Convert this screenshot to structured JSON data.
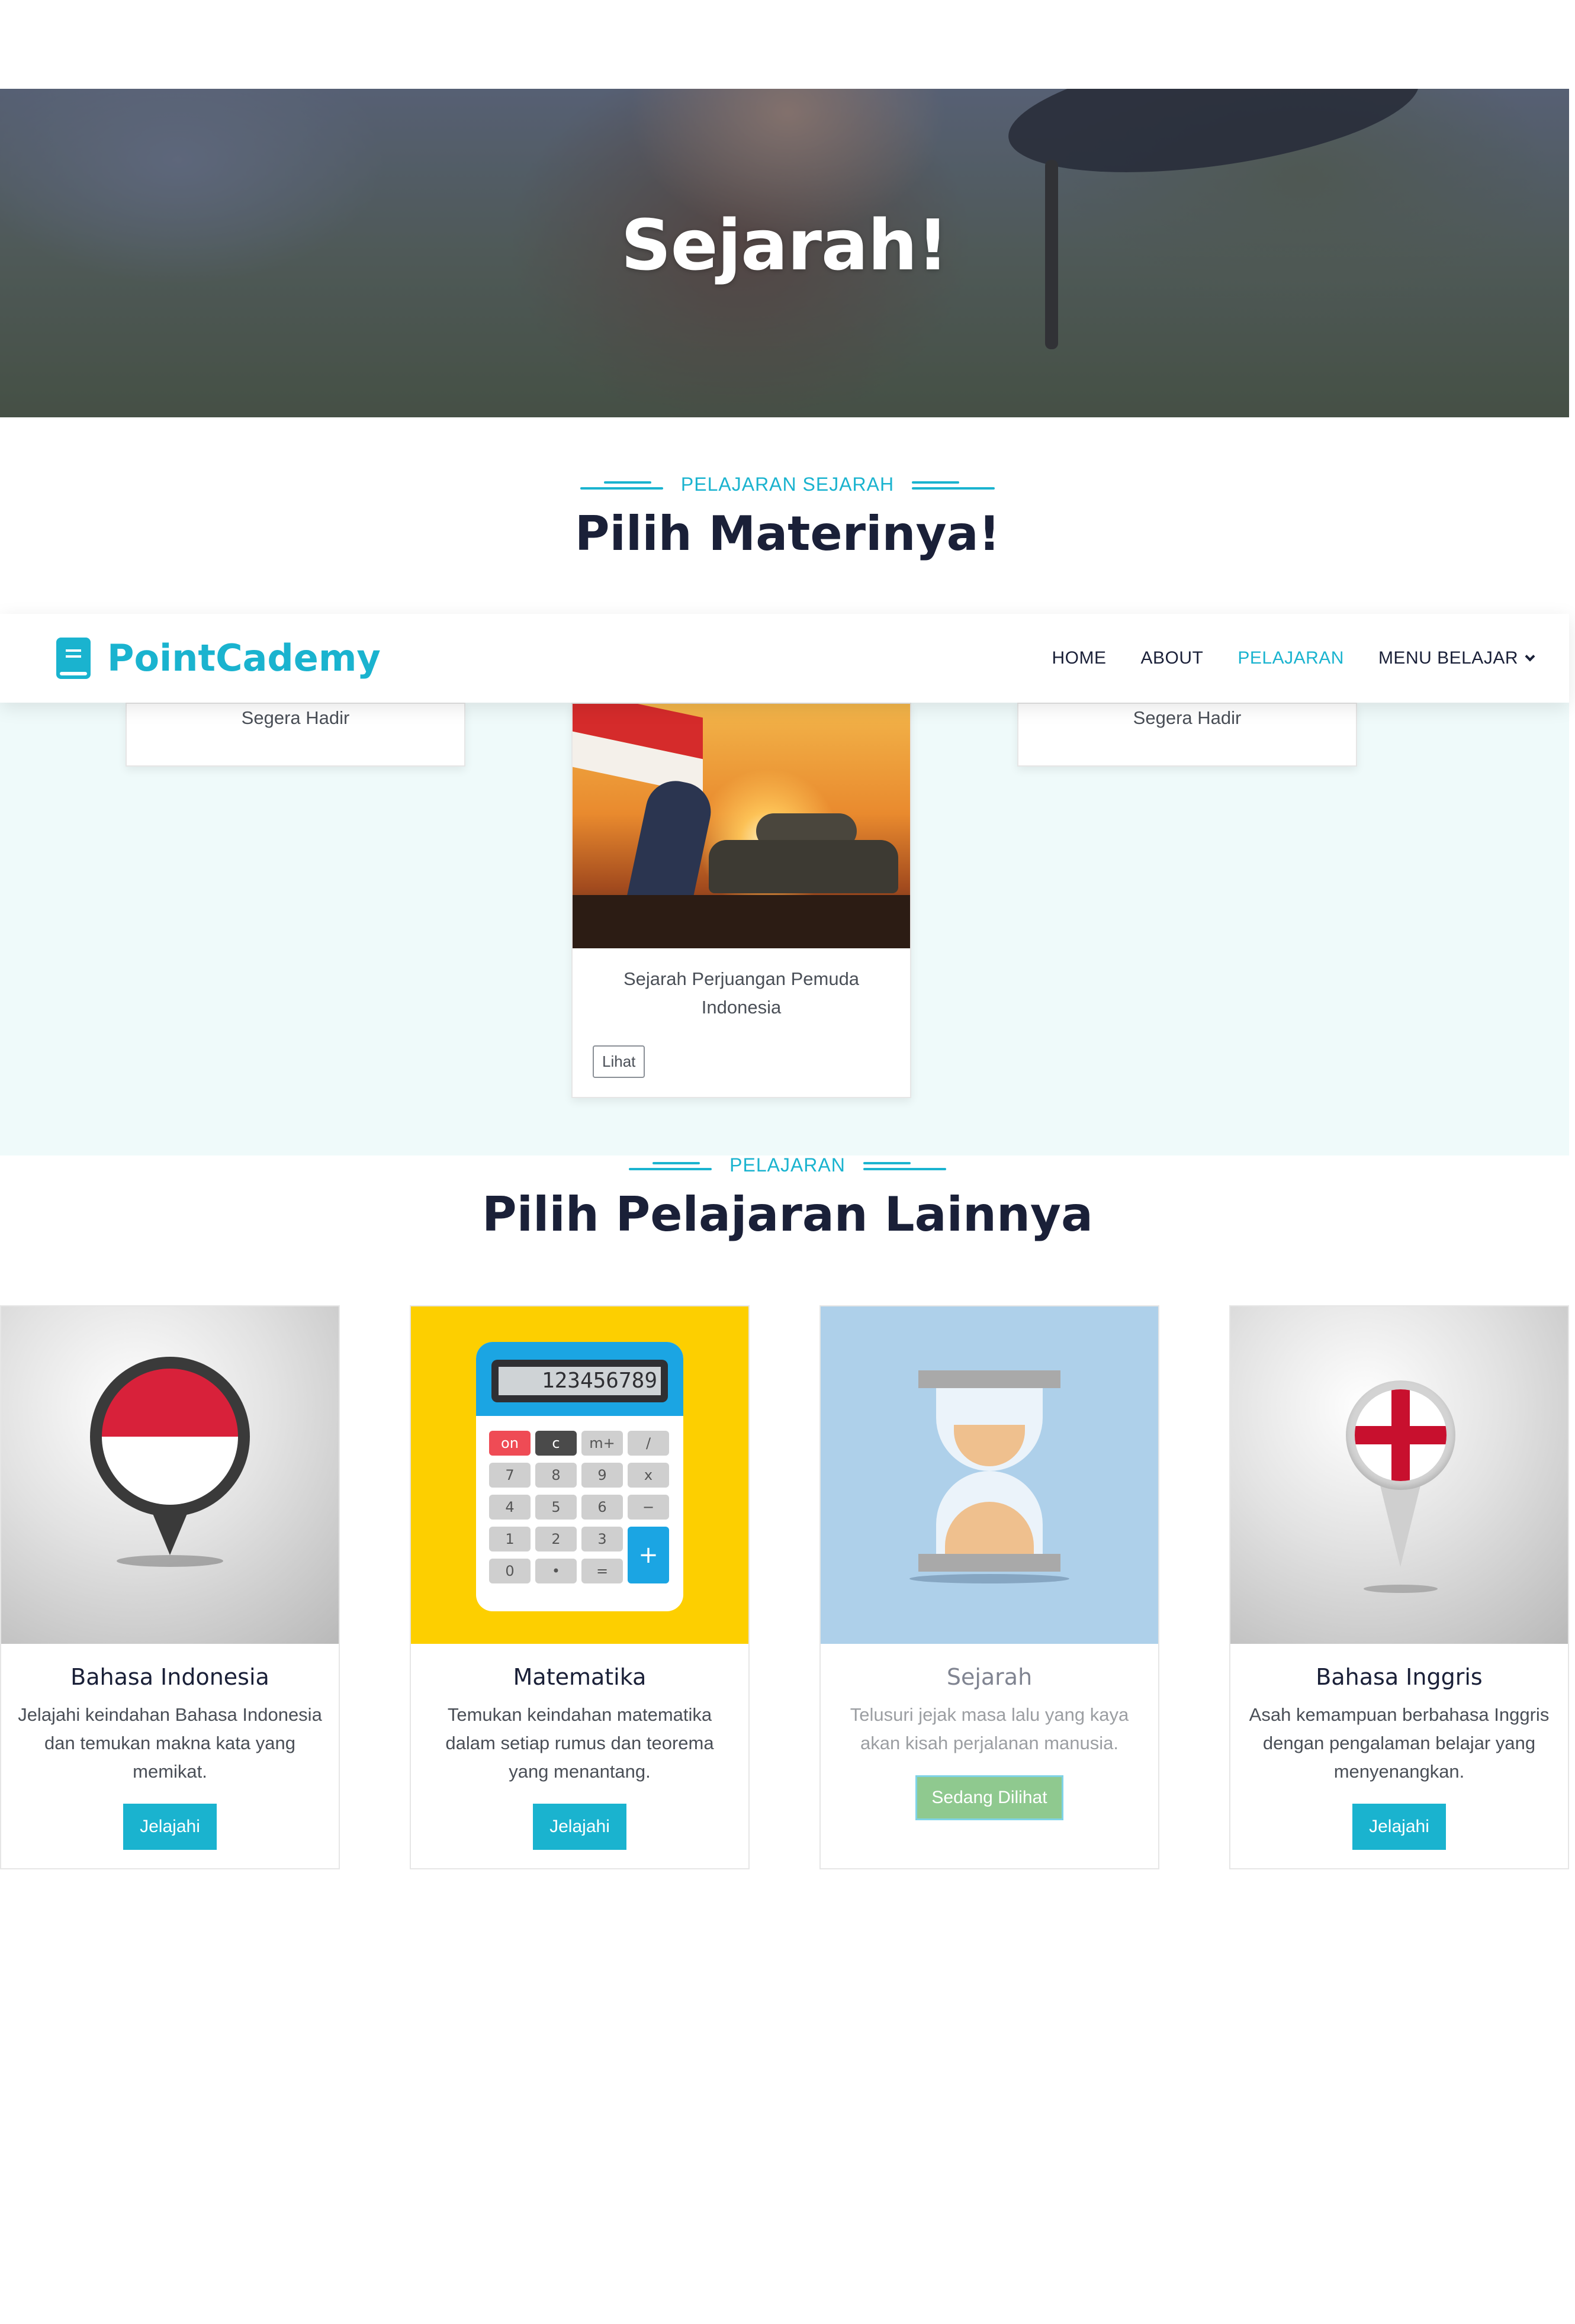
{
  "hero": {
    "title": "Sejarah!"
  },
  "section_materi": {
    "subtitle": "PELAJARAN SEJARAH",
    "title": "Pilih Materinya!"
  },
  "navbar": {
    "brand": "PointCademy",
    "items": [
      {
        "label": "HOME"
      },
      {
        "label": "ABOUT"
      },
      {
        "label": "PELAJARAN",
        "active": true
      },
      {
        "label": "MENU BELAJAR",
        "has_dropdown": true
      }
    ]
  },
  "materi_cards": [
    {
      "text": "Segera Hadir"
    },
    {
      "text": "Sejarah Perjuangan Pemuda Indonesia",
      "button": "Lihat"
    },
    {
      "text": "Segera Hadir"
    }
  ],
  "section_lainnya": {
    "subtitle": "PELAJARAN",
    "title": "Pilih Pelajaran Lainnya"
  },
  "courses": [
    {
      "title": "Bahasa Indonesia",
      "desc": "Jelajahi keindahan Bahasa Indonesia dan temukan makna kata yang memikat.",
      "button": "Jelajahi",
      "icon": "indonesia-pin-icon"
    },
    {
      "title": "Matematika",
      "desc": "Temukan keindahan matematika dalam setiap rumus dan teorema yang menantang.",
      "button": "Jelajahi",
      "icon": "calculator-icon",
      "calc_display": "123456789",
      "calc_keys": [
        "on",
        "c",
        "m+",
        "/",
        "7",
        "8",
        "9",
        "x",
        "4",
        "5",
        "6",
        "−",
        "1",
        "2",
        "3",
        "+",
        "0",
        "•",
        "="
      ]
    },
    {
      "title": "Sejarah",
      "desc": "Telusuri jejak masa lalu yang kaya akan kisah perjalanan manusia.",
      "button": "Sedang Dilihat",
      "icon": "hourglass-icon"
    },
    {
      "title": "Bahasa Inggris",
      "desc": "Asah kemampuan berbahasa Inggris dengan pengalaman belajar yang menyenangkan.",
      "button": "Jelajahi",
      "icon": "england-pin-icon"
    }
  ],
  "colors": {
    "accent": "#1ab3cf",
    "heading": "#1a2038",
    "viewing_button": "#8fc98f",
    "materi_bg": "#effafa"
  }
}
